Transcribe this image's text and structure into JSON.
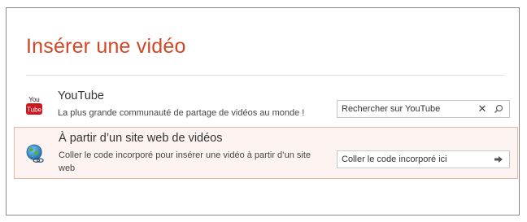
{
  "dialog": {
    "title": "Insérer une vidéo"
  },
  "youtube": {
    "icon": "youtube-icon",
    "icon_lines": [
      "You",
      "Tube"
    ],
    "icon_color": "#cc181e",
    "title": "YouTube",
    "description": "La plus grande communauté de partage de vidéos au monde !",
    "search_placeholder": "Rechercher sur YouTube",
    "clear_icon": "close-icon",
    "search_icon": "search-icon"
  },
  "web": {
    "icon": "globe-link-icon",
    "title": "À partir d’un site web de vidéos",
    "description": "Coller le code incorporé pour insérer une vidéo à partir d’un site web",
    "embed_placeholder": "Coller le code incorporé ici",
    "submit_icon": "arrow-right-icon"
  },
  "colors": {
    "accent": "#d24726",
    "selected_row_background": "#fdf3f1",
    "selected_row_border": "#e9b6aa"
  }
}
